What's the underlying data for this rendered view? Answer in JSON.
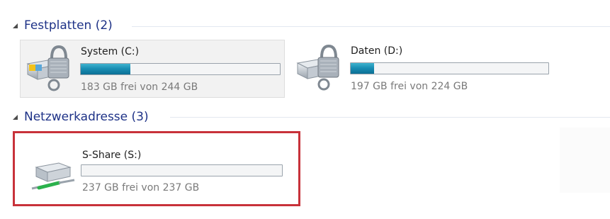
{
  "groups": [
    {
      "title": "Festplatten (2)",
      "drives": [
        {
          "name": "System (C:)",
          "free_text": "183 GB frei von 244 GB",
          "used_fraction": 0.25,
          "icon": "locked-system-drive-icon"
        },
        {
          "name": "Daten (D:)",
          "free_text": "197 GB frei von 224 GB",
          "used_fraction": 0.12,
          "icon": "locked-hard-drive-icon"
        }
      ]
    },
    {
      "title": "Netzwerkadresse (3)",
      "drives": [
        {
          "name": "S-Share (S:)",
          "free_text": "237 GB frei von 237 GB",
          "used_fraction": 0.0,
          "icon": "network-drive-icon"
        }
      ]
    }
  ],
  "colors": {
    "header_text": "#1e3287",
    "bar_fill": "#1a8fb4",
    "highlight_border": "#c8323a"
  }
}
